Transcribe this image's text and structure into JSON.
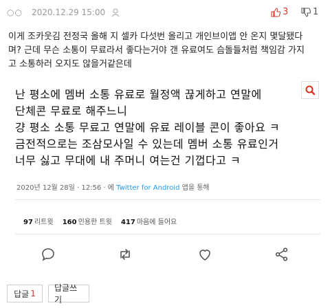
{
  "meta": {
    "dots": "○○",
    "date": "2020.12.29 15:00",
    "upvotes": "3",
    "downvotes": "1"
  },
  "post": {
    "lines": [
      "이게 조카웃김 전정국 올해 지 셀카 다섯번 올리고 개인브이앱 안 온지 몇달됐다",
      "며? 근데 무슨 소통이 무료라서 좋다는거야 갠 유료여도 슴돌들처럼 책임감 가지",
      "고 소통하러 오지도 않을거같은데"
    ]
  },
  "tweet": {
    "lines": [
      "난 평소에 멤버 소통 유료로 월정액 끊게하고 연말에",
      "단체콘 무료로 해주느니",
      "걍 평소 소통 무료고 연말에 유료 레이블 콘이 좋아요 ㅋ",
      "금전적으로는 조삼모사일 수 있는데 멤버 소통 유료인거",
      "너무 싫고 무대에 내 주머니 여는건 기껍다고 ㅋ"
    ],
    "timestamp": "2020년 12월 28일 · 12:56 · 에",
    "via": "Twitter for Android",
    "via_suffix": "앱을 통해",
    "retweets_count": "97",
    "retweets_label": "리트윗",
    "quotes_count": "160",
    "quotes_label": "인용한 트윗",
    "likes_count": "417",
    "likes_label": "마음에 들어요"
  },
  "buttons": {
    "reply_label": "답글",
    "reply_count": "1",
    "write_reply_label": "답글쓰기"
  },
  "colors": {
    "accent": "#e03a2e",
    "twitter_blue": "#1d9bf0"
  },
  "icons": [
    "user-icon",
    "thumbs-up-icon",
    "thumbs-down-icon",
    "search-icon",
    "reply-icon",
    "retweet-icon",
    "like-icon",
    "share-icon"
  ]
}
